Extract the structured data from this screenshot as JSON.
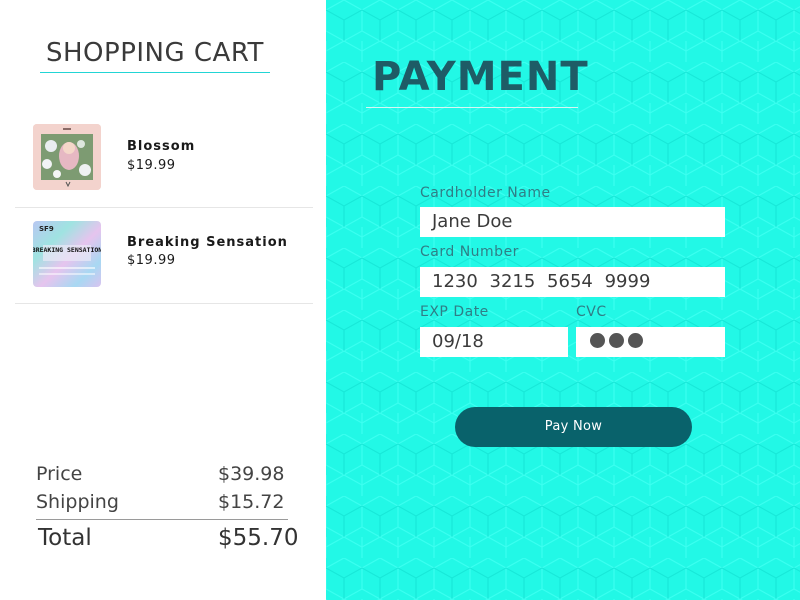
{
  "cart": {
    "title": "SHOPPING CART",
    "items": [
      {
        "name": "Blossom",
        "price": "$19.99"
      },
      {
        "name": "Breaking Sensation",
        "price": "$19.99",
        "art_text": "BREAKING SENSATION",
        "art_logo": "SF9"
      }
    ],
    "summary": {
      "price_label": "Price",
      "price_value": "$39.98",
      "shipping_label": "Shipping",
      "shipping_value": "$15.72",
      "total_label": "Total",
      "total_value": "$55.70"
    }
  },
  "payment": {
    "title": "PAYMENT",
    "cardholder_label": "Cardholder Name",
    "cardholder_value": "Jane Doe",
    "card_number_label": "Card Number",
    "card_number_value": "1230 3215 5654 9999",
    "exp_label": "EXP Date",
    "exp_value": "09/18",
    "cvc_label": "CVC",
    "pay_button": "Pay Now"
  },
  "colors": {
    "accent": "#22d5d5",
    "payment_bg": "#22f8e6",
    "button": "#09626b",
    "title": "#1e5c66"
  }
}
